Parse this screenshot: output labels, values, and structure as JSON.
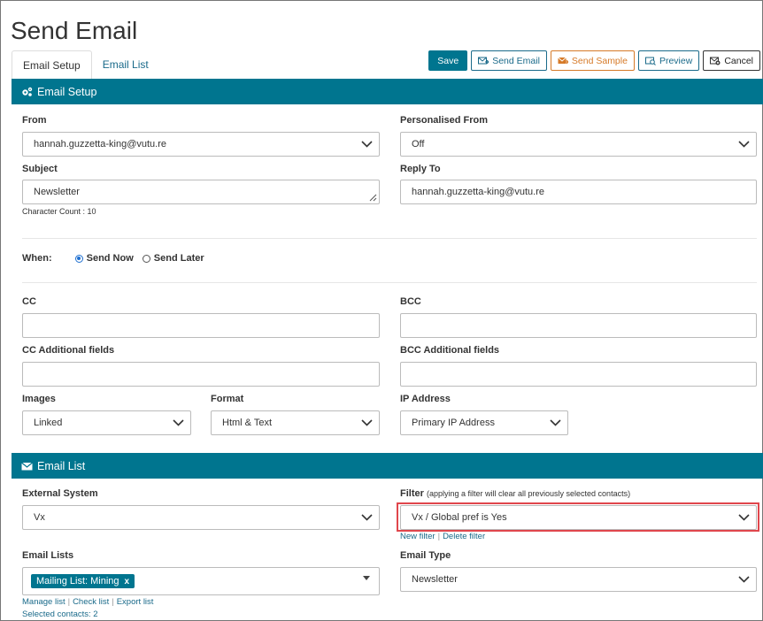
{
  "page": {
    "title": "Send Email"
  },
  "tabs": [
    {
      "label": "Email Setup",
      "active": true
    },
    {
      "label": "Email List",
      "active": false
    }
  ],
  "toolbar": {
    "save": "Save",
    "send_email": "Send Email",
    "send_sample": "Send Sample",
    "preview": "Preview",
    "cancel": "Cancel"
  },
  "setup": {
    "header": "Email Setup",
    "from_label": "From",
    "from_value": "hannah.guzzetta-king@vutu.re",
    "personalised_from_label": "Personalised From",
    "personalised_from_value": "Off",
    "subject_label": "Subject",
    "subject_value": "Newsletter",
    "character_count": "Character Count : 10",
    "reply_to_label": "Reply To",
    "reply_to_value": "hannah.guzzetta-king@vutu.re",
    "when_label": "When:",
    "send_now": "Send Now",
    "send_later": "Send Later",
    "send_now_selected": true,
    "cc_label": "CC",
    "cc_value": "",
    "bcc_label": "BCC",
    "bcc_value": "",
    "cc_additional_label": "CC Additional fields",
    "cc_additional_value": "",
    "bcc_additional_label": "BCC Additional fields",
    "bcc_additional_value": "",
    "images_label": "Images",
    "images_value": "Linked",
    "format_label": "Format",
    "format_value": "Html & Text",
    "ip_label": "IP Address",
    "ip_value": "Primary IP Address"
  },
  "list": {
    "header": "Email List",
    "external_system_label": "External System",
    "external_system_value": "Vx",
    "filter_label": "Filter",
    "filter_note": "(applying a filter will clear all previously selected contacts)",
    "filter_value": "Vx / Global pref is Yes",
    "new_filter": "New filter",
    "delete_filter": "Delete filter",
    "email_lists_label": "Email Lists",
    "email_list_tag": "Mailing List: Mining",
    "tag_remove": "x",
    "manage_list": "Manage list",
    "check_list": "Check list",
    "export_list": "Export list",
    "selected_contacts": "Selected contacts: 2",
    "email_type_label": "Email Type",
    "email_type_value": "Newsletter"
  },
  "colors": {
    "primary": "#00758f",
    "orange": "#d67a28",
    "highlight": "#e0464c",
    "radio": "#1e6fd0"
  }
}
